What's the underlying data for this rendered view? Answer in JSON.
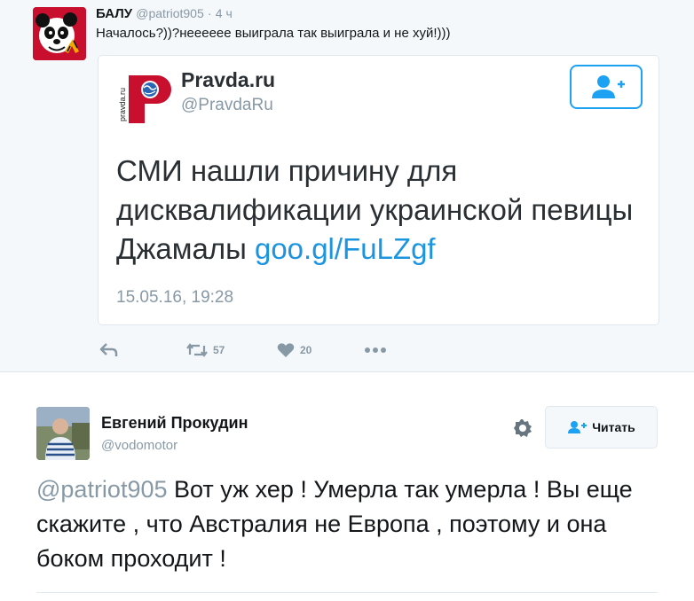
{
  "top_tweet": {
    "name": "БАЛУ",
    "handle": "@patriot905",
    "separator": "·",
    "time": "4 ч",
    "text": "Началось?))?неееeee выиграла так выиграла и не хуй!)))",
    "quoted": {
      "name": "Pravda.ru",
      "handle": "@PravdaRu",
      "logo_text": "pravda.ru",
      "text": "СМИ нашли причину для дисквалификации украинской певицы Джамалы ",
      "link": "goo.gl/FuLZgf",
      "date": "15.05.16, 19:28",
      "follow_icon": "add-user-icon"
    },
    "actions": {
      "reply_icon": "reply-icon",
      "retweet_icon": "retweet-icon",
      "retweet_count": "57",
      "like_icon": "heart-icon",
      "like_count": "20",
      "more_icon": "more-icon"
    }
  },
  "reply_tweet": {
    "name": "Евгений Прокудин",
    "handle": "@vodomotor",
    "follow_label": "Читать",
    "mention": "@patriot905",
    "text": " Вот уж хер ! Умерла так умерла ! Вы еще скажите , что Австралия не Европа , поэтому и она боком проходит !"
  },
  "colors": {
    "accent": "#1da1f2",
    "link": "#1b95e0",
    "muted": "#8899a6",
    "brand_red": "#c8102e"
  }
}
